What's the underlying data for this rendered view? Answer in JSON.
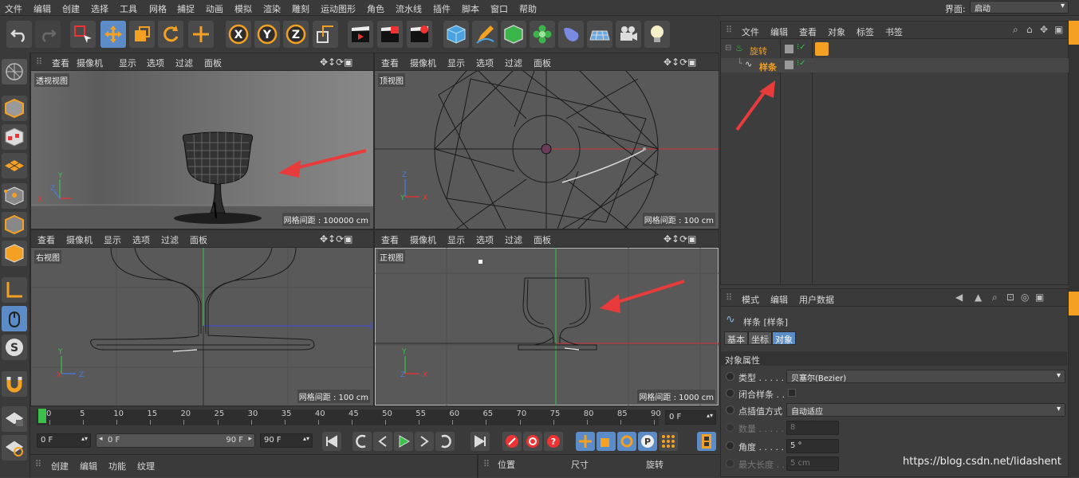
{
  "menu": [
    "文件",
    "编辑",
    "创建",
    "选择",
    "工具",
    "网格",
    "捕捉",
    "动画",
    "模拟",
    "渲染",
    "雕刻",
    "运动图形",
    "角色",
    "流水线",
    "插件",
    "脚本",
    "窗口",
    "帮助"
  ],
  "interface": {
    "label": "界面:",
    "value": "启动"
  },
  "viewport_menu": [
    "查看",
    "摄像机",
    "显示",
    "选项",
    "过滤",
    "面板"
  ],
  "viewports": [
    {
      "name": "透视视图",
      "grid": "网格间距 : 100000 cm"
    },
    {
      "name": "顶视图",
      "grid": "网格间距 : 100 cm"
    },
    {
      "name": "右视图",
      "grid": "网格间距 : 100 cm"
    },
    {
      "name": "正视图",
      "grid": "网格间距 : 1000 cm"
    }
  ],
  "object_manager": {
    "menu": [
      "文件",
      "编辑",
      "查看",
      "对象",
      "标签",
      "书签"
    ],
    "objects": [
      {
        "name": "旋转"
      },
      {
        "name": "样条"
      }
    ]
  },
  "attr_manager": {
    "menu": [
      "模式",
      "编辑",
      "用户数据"
    ],
    "title": "样条 [样条]",
    "tabs": [
      "基本",
      "坐标",
      "对象"
    ],
    "section": "对象属性",
    "props": [
      {
        "label": "类型 . . . . .",
        "value": "贝塞尔(Bezier)"
      },
      {
        "label": "闭合样条 . .",
        "value": ""
      },
      {
        "label": "点插值方式",
        "value": "自动适应"
      },
      {
        "label": "数量 . . . . .",
        "value": "8"
      },
      {
        "label": "角度 . . . . .",
        "value": "5 °"
      },
      {
        "label": "最大长度 . .",
        "value": "5 cm"
      }
    ]
  },
  "timeline": {
    "ticks": [
      "0",
      "5",
      "10",
      "15",
      "20",
      "25",
      "30",
      "35",
      "40",
      "45",
      "50",
      "55",
      "60",
      "65",
      "70",
      "75",
      "80",
      "85",
      "90"
    ],
    "current_frame": "0 F"
  },
  "playback": {
    "start": "0 F",
    "range_start": "0 F",
    "range_end": "90 F",
    "end": "90 F"
  },
  "bottom_left_menu": [
    "创建",
    "编辑",
    "功能",
    "纹理"
  ],
  "bottom_right_headers": [
    "位置",
    "尺寸",
    "旋转"
  ],
  "watermark": "https://blog.csdn.net/lidashent"
}
